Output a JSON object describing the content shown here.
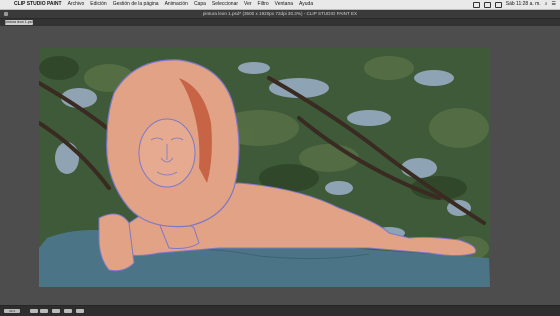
{
  "menubar": {
    "app_name": "CLIP STUDIO PAINT",
    "items": [
      "Archivo",
      "Edición",
      "Gestión de la página",
      "Animación",
      "Capa",
      "Seleccionar",
      "Ver",
      "Filtro",
      "Ventana",
      "Ayuda"
    ],
    "clock": "Sáb 11:28 a. m."
  },
  "window": {
    "title": "pintura leon 1.psd* (3500 x 1920px 72dpi 30.3%)  - CLIP STUDIO PAINT EX"
  },
  "document_tab": {
    "label": "pintura leon 1.psd"
  },
  "status_bar": {
    "zoom": "30.3"
  }
}
